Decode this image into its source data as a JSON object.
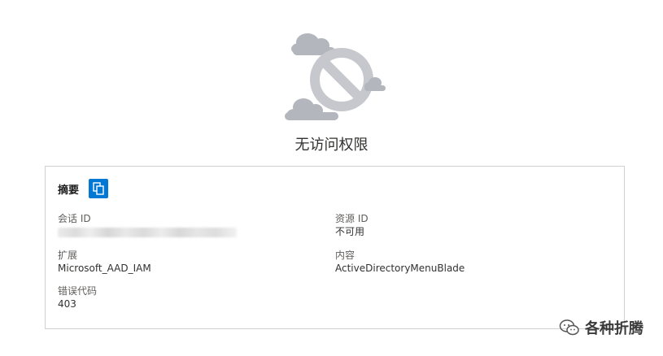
{
  "error": {
    "title": "无访问权限"
  },
  "summary": {
    "title": "摘要",
    "copy_icon": "copy-icon",
    "fields": {
      "session_id": {
        "label": "会话 ID",
        "value": ""
      },
      "resource_id": {
        "label": "资源 ID",
        "value": "不可用"
      },
      "extension": {
        "label": "扩展",
        "value": "Microsoft_AAD_IAM"
      },
      "content": {
        "label": "内容",
        "value": "ActiveDirectoryMenuBlade"
      },
      "error_code": {
        "label": "错误代码",
        "value": "403"
      }
    }
  },
  "watermark": {
    "text": "各种折腾",
    "icon": "wechat-icon"
  },
  "colors": {
    "accent": "#0078d4",
    "cloud": "#b3b6bd",
    "prohibited": "#c8cacf",
    "border": "#d2d2d2"
  }
}
